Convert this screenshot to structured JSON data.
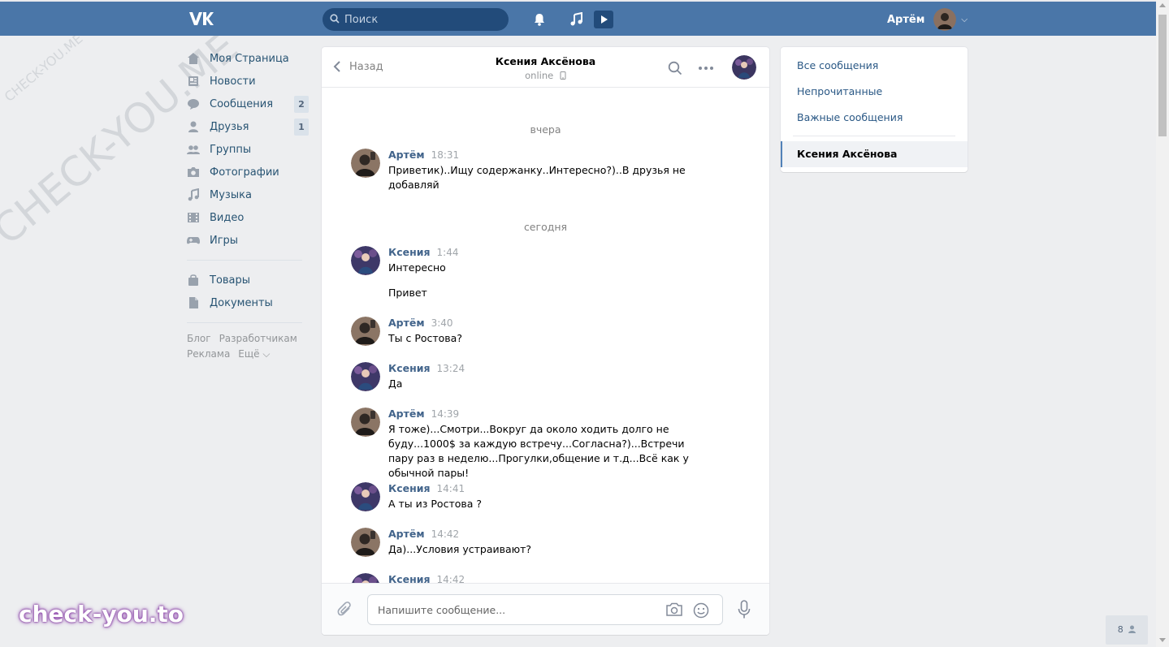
{
  "header": {
    "logo_text": "VK",
    "search_placeholder": "Поиск",
    "user_name": "Артём"
  },
  "leftnav": {
    "items": [
      {
        "label": "Моя Страница",
        "icon": "home-icon"
      },
      {
        "label": "Новости",
        "icon": "news-icon"
      },
      {
        "label": "Сообщения",
        "icon": "messages-icon",
        "badge": "2"
      },
      {
        "label": "Друзья",
        "icon": "friends-icon",
        "badge": "1"
      },
      {
        "label": "Группы",
        "icon": "groups-icon"
      },
      {
        "label": "Фотографии",
        "icon": "photo-icon"
      },
      {
        "label": "Музыка",
        "icon": "music-icon"
      },
      {
        "label": "Видео",
        "icon": "video-icon"
      },
      {
        "label": "Игры",
        "icon": "games-icon"
      }
    ],
    "items2": [
      {
        "label": "Товары",
        "icon": "shop-icon"
      },
      {
        "label": "Документы",
        "icon": "docs-icon"
      }
    ],
    "footer": [
      "Блог",
      "Разработчикам",
      "Реклама",
      "Ещё ⌵"
    ]
  },
  "chat": {
    "back_label": "Назад",
    "peer_name": "Ксения Аксёнова",
    "peer_status": "online",
    "composer_placeholder": "Напишите сообщение...",
    "days": [
      "вчера",
      "сегодня"
    ],
    "messages": [
      {
        "author": "Артём",
        "time": "18:31",
        "text": "Приветик)..Ищу содержанку..Интересно?)..В друзья не добавляй",
        "text2": ""
      },
      {
        "author": "Ксения",
        "time": "1:44",
        "text": "Интересно",
        "text2": "Привет"
      },
      {
        "author": "Артём",
        "time": "3:40",
        "text": "Ты с Ростова?",
        "text2": ""
      },
      {
        "author": "Ксения",
        "time": "13:24",
        "text": "Да",
        "text2": ""
      },
      {
        "author": "Артём",
        "time": "14:39",
        "text": "Я тоже)...Смотри...Вокруг да около ходить долго не буду...1000$ за каждую встречу...Согласна?)...Встречи пару раз в неделю...Прогулки,общение и т.д...Всё как у обычной пары!",
        "text2": ""
      },
      {
        "author": "Ксения",
        "time": "14:41",
        "text": "А ты из Ростова ?",
        "text2": ""
      },
      {
        "author": "Артём",
        "time": "14:42",
        "text": "Да)...Условия устраивают?",
        "text2": ""
      },
      {
        "author": "Ксения",
        "time": "14:42",
        "text": "",
        "text2": ""
      }
    ]
  },
  "rightpanel": {
    "items": [
      "Все сообщения",
      "Непрочитанные",
      "Важные сообщения"
    ],
    "active": "Ксения Аксёнова"
  },
  "watermarks": {
    "big": "CHECK-YOU.ME",
    "small": "CHECK-YOU.ME",
    "bottom": "check-you.to"
  },
  "online_count": "8",
  "colors": {
    "header_bg": "#4a76a8",
    "page_bg": "#edeef0",
    "link": "#2a5885",
    "author": "#42648b"
  }
}
